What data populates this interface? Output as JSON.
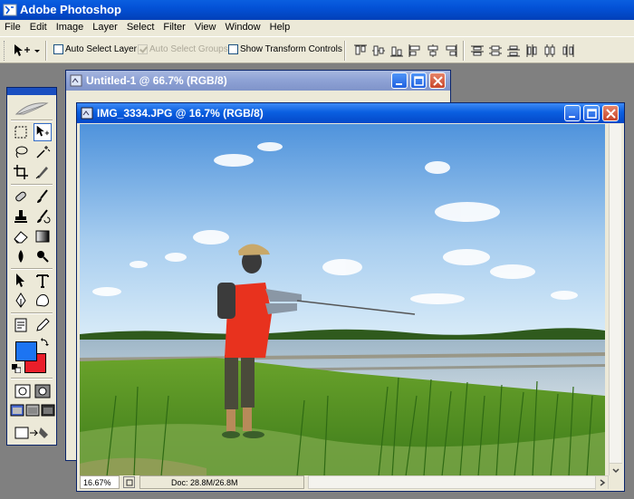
{
  "app": {
    "title": "Adobe Photoshop"
  },
  "menu": [
    "File",
    "Edit",
    "Image",
    "Layer",
    "Select",
    "Filter",
    "View",
    "Window",
    "Help"
  ],
  "options": {
    "auto_select_layer": "Auto Select Layer",
    "auto_select_groups": "Auto Select Groups",
    "show_transform_controls": "Show Transform Controls"
  },
  "windows": {
    "back": {
      "title": "Untitled-1 @ 66.7% (RGB/8)"
    },
    "front": {
      "title": "IMG_3334.JPG @ 16.7% (RGB/8)",
      "status_zoom": "16.67%",
      "status_doc": "Doc: 28.8M/26.8M"
    }
  },
  "toolbox": {
    "foreground_color": "#1c74f2",
    "background_color": "#ea1e2a"
  },
  "colors": {
    "titlebar": "#0351d6",
    "chrome": "#ece9d8",
    "workspace": "#808080"
  }
}
